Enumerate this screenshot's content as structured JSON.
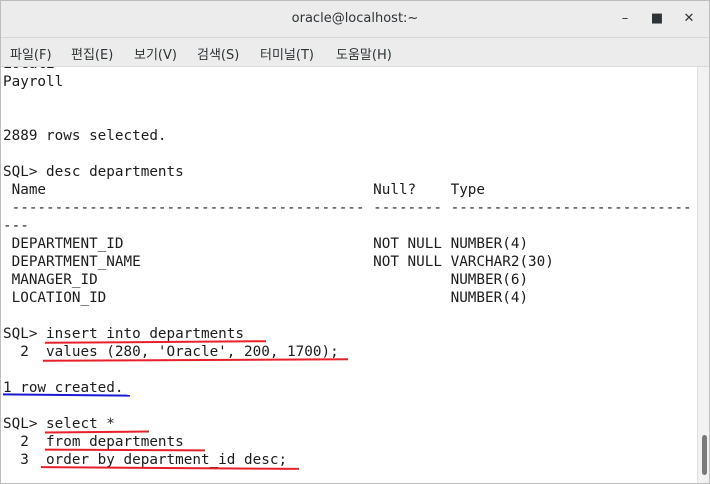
{
  "window": {
    "title": "oracle@localhost:~",
    "minimize_label": "–",
    "maximize_label": "■",
    "close_label": "✕"
  },
  "menu": {
    "items": [
      {
        "label": "파일(F)"
      },
      {
        "label": "편집(E)"
      },
      {
        "label": "보기(V)"
      },
      {
        "label": "검색(S)"
      },
      {
        "label": "터미널(T)"
      },
      {
        "label": "도움말(H)"
      }
    ]
  },
  "terminal": {
    "lines": [
      "Payroll",
      "",
      "",
      "2889 rows selected.",
      "",
      "SQL> desc departments",
      " Name                                      Null?    Type",
      " ----------------------------------------- -------- ----------------------------",
      "---",
      " DEPARTMENT_ID                             NOT NULL NUMBER(4)",
      " DEPARTMENT_NAME                           NOT NULL VARCHAR2(30)",
      " MANAGER_ID                                         NUMBER(6)",
      " LOCATION_ID                                        NUMBER(4)",
      "",
      "SQL> insert into departments",
      "  2  values (280, 'Oracle', 200, 1700);",
      "",
      "1 row created.",
      "",
      "SQL> select *",
      "  2  from departments",
      "  3  order by department_id desc;"
    ]
  },
  "annotation_colors": {
    "red": "#e8202a",
    "blue": "#1a1ad6"
  },
  "scrollbar": {
    "position": 0.95
  }
}
